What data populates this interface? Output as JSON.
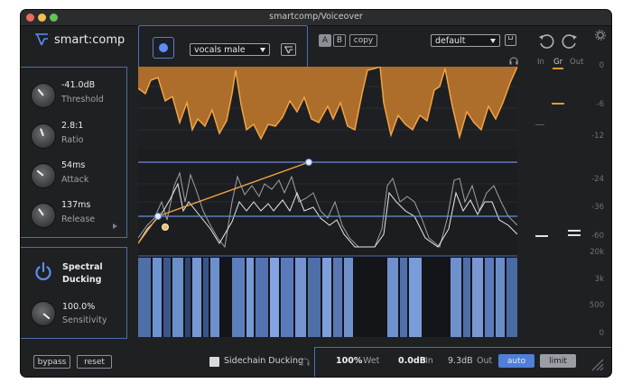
{
  "window": {
    "title": "smartcomp/Voiceover"
  },
  "brand": {
    "name": "smart:comp"
  },
  "preset": {
    "value": "vocals male"
  },
  "ab": {
    "a": "A",
    "b": "B",
    "copy": "copy"
  },
  "profile": {
    "value": "default"
  },
  "meters": {
    "in": "In",
    "gr": "Gr",
    "out": "Out"
  },
  "scale_db": [
    "0",
    "-6",
    "-12",
    "-24",
    "-36",
    "-60"
  ],
  "scale_freq": [
    "20k",
    "3k",
    "500",
    "0"
  ],
  "params": [
    {
      "value": "-41.0dB",
      "label": "Threshold"
    },
    {
      "value": "2.8:1",
      "label": "Ratio"
    },
    {
      "value": "54ms",
      "label": "Attack"
    },
    {
      "value": "137ms",
      "label": "Release"
    }
  ],
  "ducking": {
    "title1": "Spectral",
    "title2": "Ducking",
    "sens_value": "100.0%",
    "sens_label": "Sensitivity"
  },
  "footer": {
    "bypass": "bypass",
    "reset": "reset",
    "sidechain": "Sidechain Ducking",
    "wet_value": "100%",
    "wet_label": "Wet",
    "in_value": "0.0dB",
    "in_label": "In",
    "out_value": "9.3dB",
    "out_label": "Out",
    "auto": "auto",
    "limit": "limit"
  },
  "colors": {
    "accent": "#4a6fb1",
    "orange": "#e8953a",
    "active": "#4f7fd6"
  }
}
